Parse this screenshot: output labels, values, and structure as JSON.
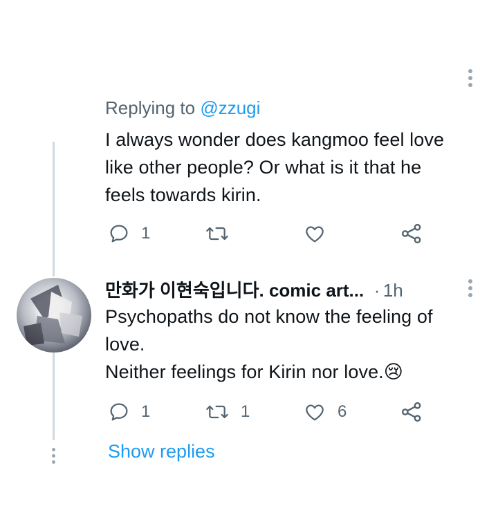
{
  "tweet1": {
    "replying_prefix": "Replying to",
    "replying_handle": "@zzugi",
    "text_lines": [
      "I always wonder does kangmoo feel love",
      "like other people? Or what is it that he",
      "feels towards kirin."
    ],
    "reply_count": "1",
    "retweet_count": "",
    "like_count": ""
  },
  "tweet2": {
    "author_name": "만화가 이현숙입니다. comic art...",
    "separator": "·",
    "time": "1h",
    "text_lines": [
      "Psychopaths do not know the feeling of",
      "love.",
      "Neither feelings for Kirin nor love."
    ],
    "emoji": "😢",
    "reply_count": "1",
    "retweet_count": "1",
    "like_count": "6"
  },
  "show_replies_label": "Show replies",
  "icons": {
    "more": "more-vertical-icon",
    "reply": "reply-icon",
    "retweet": "retweet-icon",
    "like": "heart-icon",
    "share": "share-icon",
    "emoji": "crying-face-emoji"
  },
  "colors": {
    "text": "#0f1419",
    "secondary": "#536471",
    "accent": "#1d9bf0",
    "thread_line": "#cfd9de"
  }
}
